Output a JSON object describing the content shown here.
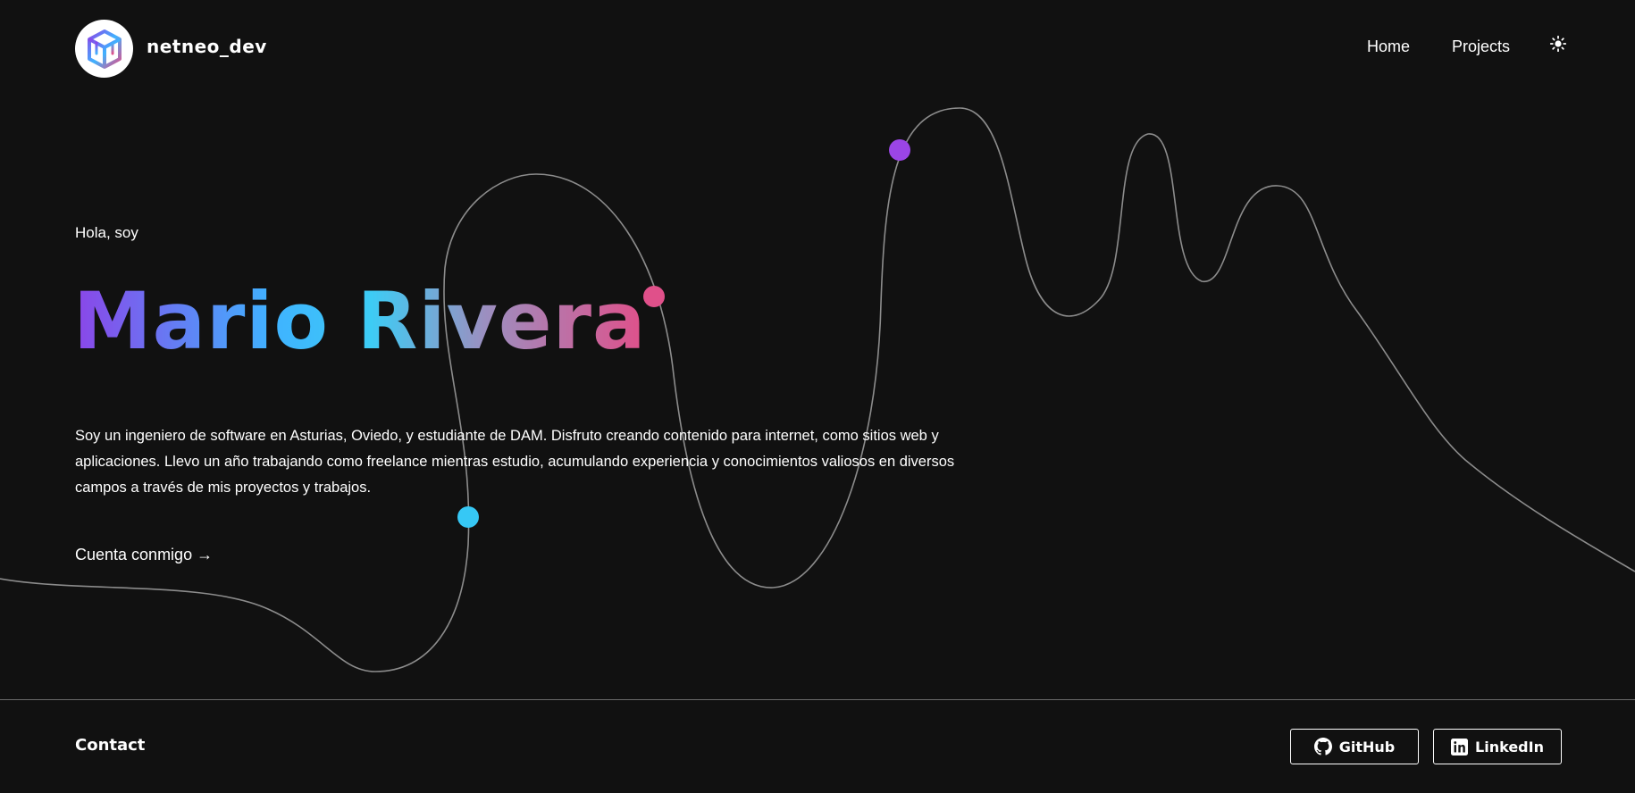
{
  "header": {
    "brand": "netneo_dev",
    "nav": {
      "home": "Home",
      "projects": "Projects"
    },
    "theme_icon": "sun-icon"
  },
  "hero": {
    "greeting": "Hola, soy",
    "name": "Mario Rivera",
    "description": "Soy un ingeniero de software en Asturias, Oviedo, y estudiante de DAM. Disfruto creando contenido para internet, como sitios web y aplicaciones. Llevo un año trabajando como freelance mientras estudio, acumulando experiencia y conocimientos valiosos en diversos campos a través de mis proyectos y trabajos.",
    "cta": "Cuenta conmigo →"
  },
  "footer": {
    "title": "Contact",
    "github": "GitHub",
    "linkedin": "LinkedIn"
  },
  "colors": {
    "background": "#111111",
    "gradient_start": "#8b45e8",
    "gradient_mid": "#3dccf5",
    "gradient_end": "#e0508a",
    "dot_purple": "#9b45e6",
    "dot_pink": "#e0508a",
    "dot_cyan": "#36c8f5"
  }
}
